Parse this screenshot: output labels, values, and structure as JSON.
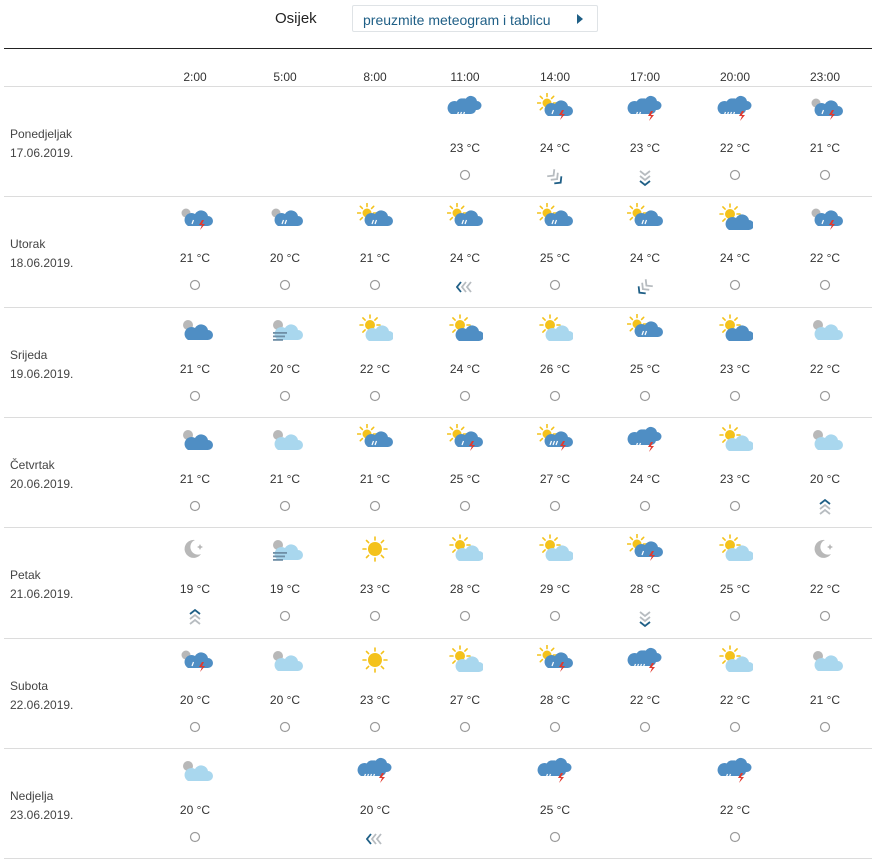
{
  "header": {
    "city": "Osijek",
    "download_label": "preuzmite meteogram i tablicu"
  },
  "hours": [
    "2:00",
    "5:00",
    "8:00",
    "11:00",
    "14:00",
    "17:00",
    "20:00",
    "23:00"
  ],
  "days": [
    {
      "name": "Ponedjeljak",
      "date": "17.06.2019.",
      "cells": [
        null,
        null,
        null,
        {
          "icon": "cloud-sleet-icon",
          "temp": "23 °C",
          "wind": "calm-icon"
        },
        {
          "icon": "sun-cloud-thunder-icon",
          "temp": "24 °C",
          "wind": "wind-arrow-southeast-icon"
        },
        {
          "icon": "cloud-sleet-thunder-icon",
          "temp": "23 °C",
          "wind": "wind-arrow-south-icon"
        },
        {
          "icon": "cloud-rain-thunder-icon",
          "temp": "22 °C",
          "wind": "calm-icon"
        },
        {
          "icon": "moon-cloud-thunder-icon",
          "temp": "21 °C",
          "wind": "calm-icon"
        }
      ]
    },
    {
      "name": "Utorak",
      "date": "18.06.2019.",
      "cells": [
        {
          "icon": "moon-cloud-thunder-icon",
          "temp": "21 °C",
          "wind": "calm-icon"
        },
        {
          "icon": "moon-cloud-sleet-icon",
          "temp": "20 °C",
          "wind": "calm-icon"
        },
        {
          "icon": "sun-cloud-sleet-icon",
          "temp": "21 °C",
          "wind": "calm-icon"
        },
        {
          "icon": "sun-cloud-sleet-icon",
          "temp": "24 °C",
          "wind": "wind-arrow-west-icon"
        },
        {
          "icon": "sun-cloud-sleet-icon",
          "temp": "25 °C",
          "wind": "calm-icon"
        },
        {
          "icon": "sun-cloud-sleet-icon",
          "temp": "24 °C",
          "wind": "wind-arrow-southwest-icon"
        },
        {
          "icon": "sun-cloud-icon",
          "temp": "24 °C",
          "wind": "calm-icon"
        },
        {
          "icon": "moon-cloud-thunder-icon",
          "temp": "22 °C",
          "wind": "calm-icon"
        }
      ]
    },
    {
      "name": "Srijeda",
      "date": "19.06.2019.",
      "cells": [
        {
          "icon": "moon-cloud-icon",
          "temp": "21 °C",
          "wind": "calm-icon"
        },
        {
          "icon": "moon-fog-icon",
          "temp": "20 °C",
          "wind": "calm-icon"
        },
        {
          "icon": "sun-light-cloud-icon",
          "temp": "22 °C",
          "wind": "calm-icon"
        },
        {
          "icon": "sun-cloud-icon",
          "temp": "24 °C",
          "wind": "calm-icon"
        },
        {
          "icon": "sun-light-cloud-icon",
          "temp": "26 °C",
          "wind": "calm-icon"
        },
        {
          "icon": "sun-cloud-sleet-icon",
          "temp": "25 °C",
          "wind": "calm-icon"
        },
        {
          "icon": "sun-cloud-icon",
          "temp": "23 °C",
          "wind": "calm-icon"
        },
        {
          "icon": "moon-light-cloud-icon",
          "temp": "22 °C",
          "wind": "calm-icon"
        }
      ]
    },
    {
      "name": "Četvrtak",
      "date": "20.06.2019.",
      "cells": [
        {
          "icon": "moon-cloud-icon",
          "temp": "21 °C",
          "wind": "calm-icon"
        },
        {
          "icon": "moon-light-cloud-icon",
          "temp": "21 °C",
          "wind": "calm-icon"
        },
        {
          "icon": "sun-cloud-sleet-icon",
          "temp": "21 °C",
          "wind": "calm-icon"
        },
        {
          "icon": "sun-cloud-thunder-icon",
          "temp": "25 °C",
          "wind": "calm-icon"
        },
        {
          "icon": "sun-cloud-rain-thunder-icon",
          "temp": "27 °C",
          "wind": "calm-icon"
        },
        {
          "icon": "cloud-sleet-thunder-icon",
          "temp": "24 °C",
          "wind": "calm-icon"
        },
        {
          "icon": "sun-light-cloud-icon",
          "temp": "23 °C",
          "wind": "calm-icon"
        },
        {
          "icon": "moon-light-cloud-icon",
          "temp": "20 °C",
          "wind": "wind-arrow-north-icon"
        }
      ]
    },
    {
      "name": "Petak",
      "date": "21.06.2019.",
      "cells": [
        {
          "icon": "moon-clear-icon",
          "temp": "19 °C",
          "wind": "wind-arrow-north-icon"
        },
        {
          "icon": "moon-fog-icon",
          "temp": "19 °C",
          "wind": "calm-icon"
        },
        {
          "icon": "sun-icon",
          "temp": "23 °C",
          "wind": "calm-icon"
        },
        {
          "icon": "sun-light-cloud-icon",
          "temp": "28 °C",
          "wind": "calm-icon"
        },
        {
          "icon": "sun-light-cloud-icon",
          "temp": "29 °C",
          "wind": "calm-icon"
        },
        {
          "icon": "sun-cloud-thunder-icon",
          "temp": "28 °C",
          "wind": "wind-arrow-south-icon"
        },
        {
          "icon": "sun-light-cloud-icon",
          "temp": "25 °C",
          "wind": "calm-icon"
        },
        {
          "icon": "moon-clear-icon",
          "temp": "22 °C",
          "wind": "calm-icon"
        }
      ]
    },
    {
      "name": "Subota",
      "date": "22.06.2019.",
      "cells": [
        {
          "icon": "moon-cloud-thunder-icon",
          "temp": "20 °C",
          "wind": "calm-icon"
        },
        {
          "icon": "moon-light-cloud-icon",
          "temp": "20 °C",
          "wind": "calm-icon"
        },
        {
          "icon": "sun-icon",
          "temp": "23 °C",
          "wind": "calm-icon"
        },
        {
          "icon": "sun-light-cloud-icon",
          "temp": "27 °C",
          "wind": "calm-icon"
        },
        {
          "icon": "sun-cloud-thunder-icon",
          "temp": "28 °C",
          "wind": "calm-icon"
        },
        {
          "icon": "cloud-rain-thunder-icon",
          "temp": "22 °C",
          "wind": "calm-icon"
        },
        {
          "icon": "sun-light-cloud-icon",
          "temp": "22 °C",
          "wind": "calm-icon"
        },
        {
          "icon": "moon-light-cloud-icon",
          "temp": "21 °C",
          "wind": "calm-icon"
        }
      ]
    },
    {
      "name": "Nedjelja",
      "date": "23.06.2019.",
      "cells": [
        {
          "icon": "moon-light-cloud-icon",
          "temp": "20 °C",
          "wind": "calm-icon"
        },
        null,
        {
          "icon": "cloud-rain-thunder-icon",
          "temp": "20 °C",
          "wind": "wind-arrow-west-icon"
        },
        null,
        {
          "icon": "cloud-sleet-thunder-icon",
          "temp": "25 °C",
          "wind": "calm-icon"
        },
        null,
        {
          "icon": "cloud-sleet-thunder-icon",
          "temp": "22 °C",
          "wind": "calm-icon"
        },
        null
      ]
    }
  ],
  "colors": {
    "cloud_dark": "#4f8ec4",
    "cloud_light": "#a9d7ee",
    "sun": "#f4c21b",
    "moon": "#b8b8b8",
    "thunder": "#e03a2f",
    "wind_dark": "#1f5f86",
    "wind_light": "#b7bcc0",
    "link": "#1f5f86"
  }
}
